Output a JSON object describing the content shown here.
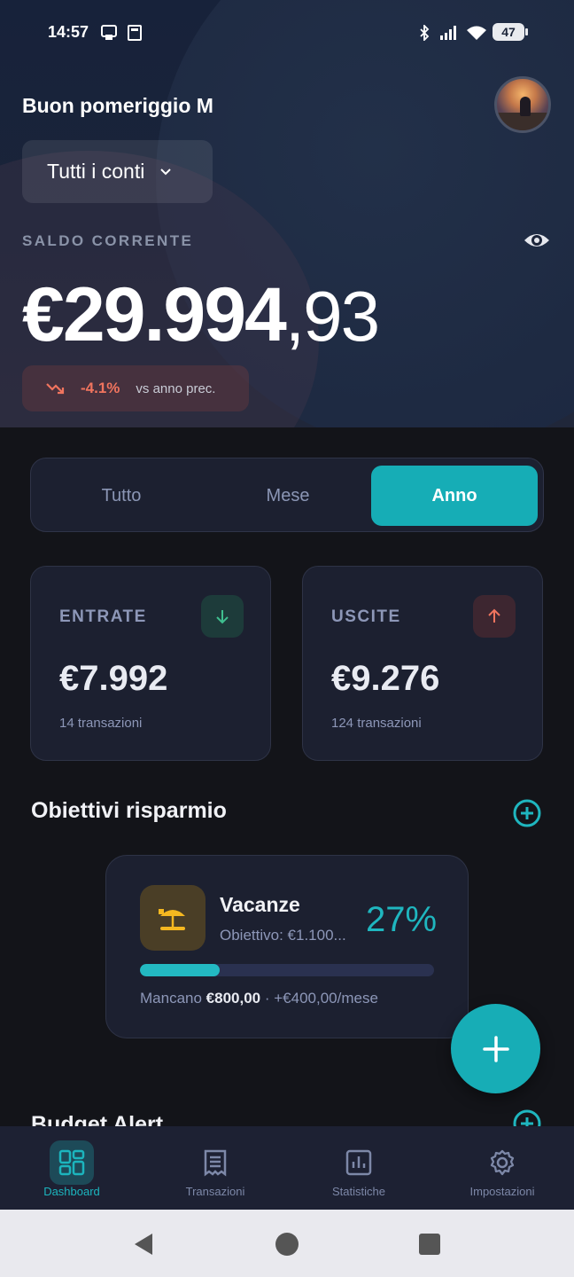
{
  "status_bar": {
    "time": "14:57",
    "battery": "47"
  },
  "header": {
    "greeting": "Buon pomeriggio M",
    "account_selector": "Tutti i conti",
    "balance_label": "SALDO CORRENTE",
    "balance_int": "€29.994",
    "balance_dec": ",93",
    "delta_pct": "-4.1%",
    "delta_text": "vs anno prec."
  },
  "period_tabs": [
    {
      "label": "Tutto",
      "active": false
    },
    {
      "label": "Mese",
      "active": false
    },
    {
      "label": "Anno",
      "active": true
    }
  ],
  "income": {
    "title": "ENTRATE",
    "amount": "€7.992",
    "sub": "14 transazioni",
    "color": "#3fbf8f"
  },
  "expenses": {
    "title": "USCITE",
    "amount": "€9.276",
    "sub": "124 transazioni",
    "color": "#f0745e"
  },
  "savings": {
    "title": "Obiettivi risparmio",
    "goal": {
      "name": "Vacanze",
      "target": "Obiettivo: €1.100...",
      "percent": "27%",
      "progress": 0.27,
      "remaining_label": "Mancano",
      "remaining_amount": "€800,00",
      "monthly": "· +€400,00/mese"
    }
  },
  "budget_alert": {
    "title": "Budget Alert"
  },
  "nav": [
    {
      "label": "Dashboard",
      "icon": "dashboard-icon",
      "active": true
    },
    {
      "label": "Transazioni",
      "icon": "receipt-icon",
      "active": false
    },
    {
      "label": "Statistiche",
      "icon": "chart-icon",
      "active": false
    },
    {
      "label": "Impostazioni",
      "icon": "gear-icon",
      "active": false
    }
  ],
  "colors": {
    "accent": "#16adb6",
    "background": "#131419",
    "card": "#1c2030",
    "negative": "#f0745e",
    "positive": "#3fbf8f"
  }
}
